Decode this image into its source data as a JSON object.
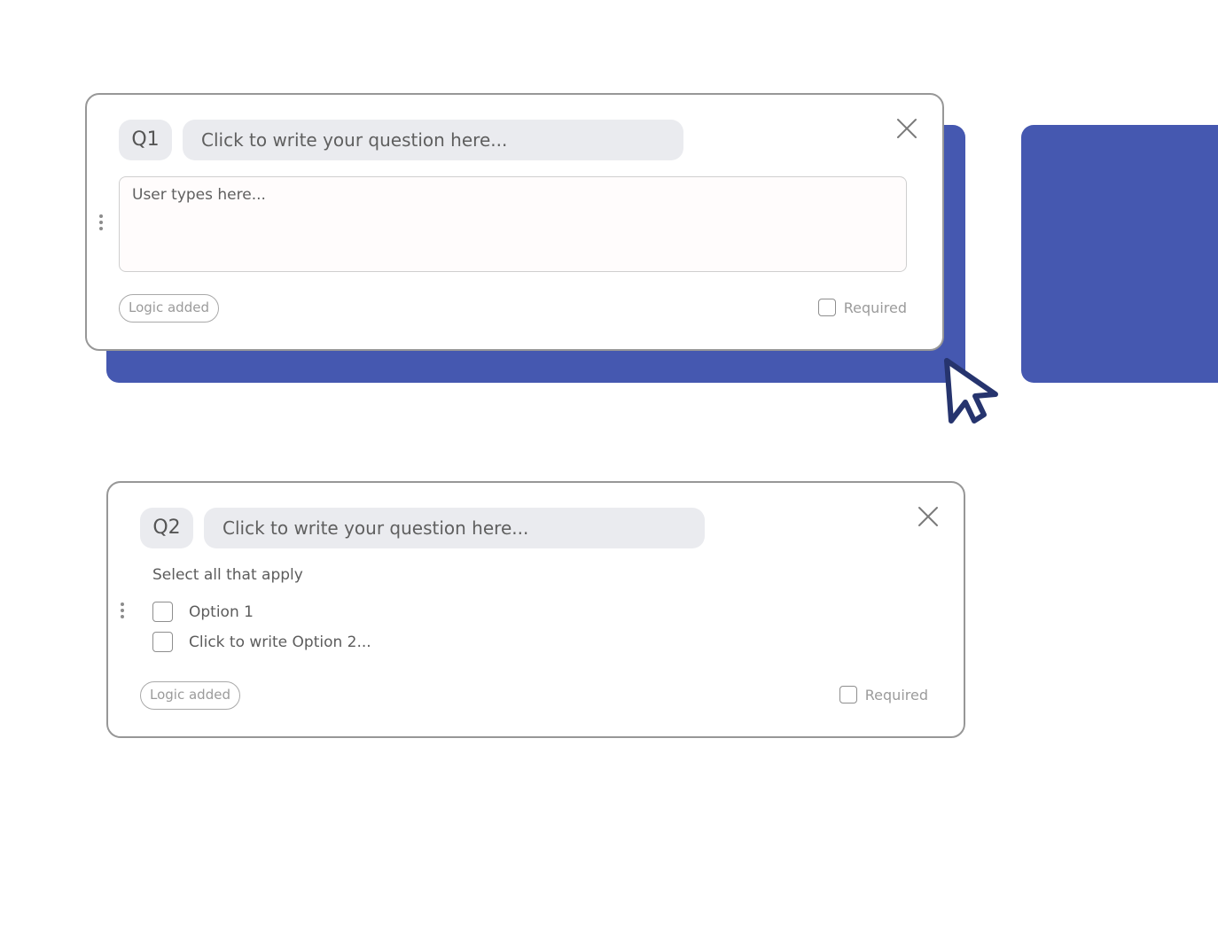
{
  "colors": {
    "drop_zone": "#4558b0",
    "card_border": "#979797",
    "pill_bg": "#eaebef",
    "cursor": "#26346e"
  },
  "q1": {
    "number": "Q1",
    "title_placeholder": "Click to write your question here...",
    "answer_placeholder": "User types here...",
    "logic_label": "Logic added",
    "required_label": "Required"
  },
  "q2": {
    "number": "Q2",
    "title_placeholder": "Click to write your question here...",
    "instruction": "Select all that apply",
    "options": [
      {
        "label": "Option 1"
      },
      {
        "label": "Click to write Option 2..."
      }
    ],
    "logic_label": "Logic added",
    "required_label": "Required"
  },
  "icons": {
    "close": "close-icon",
    "drag": "drag-handle-icon",
    "cursor": "mouse-cursor-icon"
  }
}
